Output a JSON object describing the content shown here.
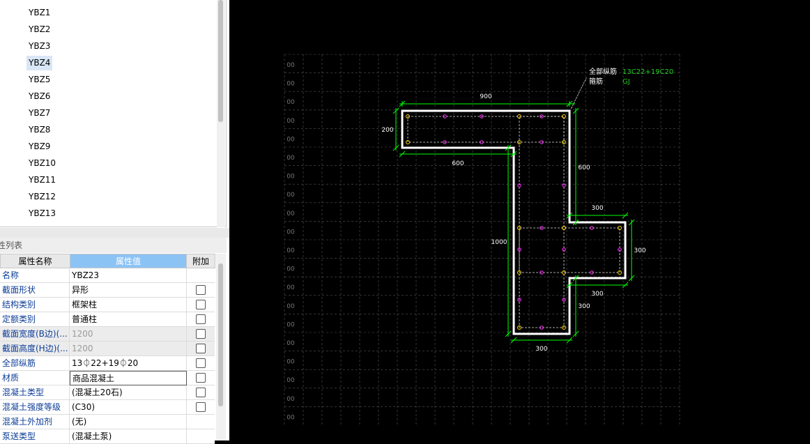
{
  "component_list": {
    "items": [
      "YBZ1",
      "YBZ2",
      "YBZ3",
      "YBZ4",
      "YBZ5",
      "YBZ6",
      "YBZ7",
      "YBZ8",
      "YBZ9",
      "YBZ10",
      "YBZ11",
      "YBZ12",
      "YBZ13"
    ],
    "selected": "YBZ4"
  },
  "properties_panel": {
    "title": "性列表",
    "headers": {
      "name": "属性名称",
      "value": "属性值",
      "extra": "附加"
    },
    "rows": [
      {
        "name": "名称",
        "value": "YBZ23",
        "checkbox": false,
        "disabled": false
      },
      {
        "name": "截面形状",
        "value": "异形",
        "checkbox": true,
        "disabled": false
      },
      {
        "name": "结构类别",
        "value": "框架柱",
        "checkbox": true,
        "disabled": false
      },
      {
        "name": "定额类别",
        "value": "普通柱",
        "checkbox": true,
        "disabled": false
      },
      {
        "name": "截面宽度(B边)(...",
        "value": "1200",
        "checkbox": true,
        "disabled": true
      },
      {
        "name": "截面高度(H边)(...",
        "value": "1200",
        "checkbox": true,
        "disabled": true
      },
      {
        "name": "全部纵筋",
        "value": "13⏀22+19⏀20",
        "checkbox": true,
        "disabled": false
      },
      {
        "name": "材质",
        "value": "商品混凝土",
        "checkbox": true,
        "disabled": false,
        "editing": true
      },
      {
        "name": "混凝土类型",
        "value": "(混凝土20石)",
        "checkbox": true,
        "disabled": false
      },
      {
        "name": "混凝土强度等级",
        "value": "(C30)",
        "checkbox": true,
        "disabled": false
      },
      {
        "name": "混凝土外加剂",
        "value": "(无)",
        "checkbox": false,
        "disabled": false
      },
      {
        "name": "泵送类型",
        "value": "(混凝土泵)",
        "checkbox": false,
        "disabled": false
      }
    ]
  },
  "drawing": {
    "grid_label": "00",
    "rebar_legend": {
      "longitudinal_label": "全部纵筋",
      "longitudinal_value": "13C22+19C20",
      "stirrup_label": "箍筋",
      "stirrup_value": "GJ"
    },
    "dimensions": {
      "top_width": "900",
      "left_height": "200",
      "lower_offset": "600",
      "right_upper": "600",
      "left_total": "1000",
      "flange_top": "300",
      "flange_height": "300",
      "flange_bottom": "300",
      "stem_lower": "300",
      "bottom_width": "300"
    },
    "colors": {
      "outline": "#ffffff",
      "dimension": "#00ff00",
      "corner_bar": "#ffd700",
      "middle_bar": "#ff33ff",
      "grid": "#555555"
    }
  }
}
